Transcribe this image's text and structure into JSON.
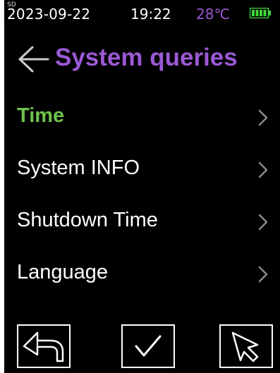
{
  "status_bar": {
    "corner_mark": "SD",
    "date": "2023-09-22",
    "time": "19:22",
    "temperature": "28℃",
    "battery_icon": "battery-full-icon",
    "battery_level": 1.0
  },
  "header": {
    "back_icon": "back-arrow-icon",
    "title": "System queries"
  },
  "menu": {
    "items": [
      {
        "label": "Time",
        "active": true,
        "icon": "chevron-right-icon"
      },
      {
        "label": "System INFO",
        "active": false,
        "icon": "chevron-right-icon"
      },
      {
        "label": "Shutdown Time",
        "active": false,
        "icon": "chevron-right-icon"
      },
      {
        "label": "Language",
        "active": false,
        "icon": "chevron-right-icon"
      }
    ]
  },
  "bottom_bar": {
    "buttons": [
      {
        "icon": "return-arrow-icon"
      },
      {
        "icon": "checkmark-icon"
      },
      {
        "icon": "pointer-cursor-icon"
      }
    ]
  },
  "colors": {
    "background": "#000000",
    "text": "#ffffff",
    "accent_purple": "#9b59d4",
    "active_green": "#6fc24d",
    "battery_green": "#3fd63a",
    "chevron_gray": "#8a8a8a"
  }
}
